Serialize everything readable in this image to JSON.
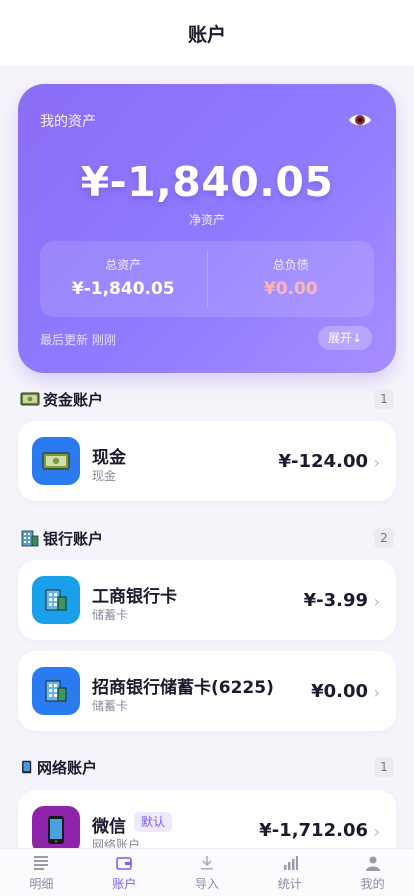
{
  "header": {
    "title": "账户"
  },
  "summary": {
    "label": "我的资产",
    "net_value": "¥-1,840.05",
    "net_label": "净资产",
    "total_assets_label": "总资产",
    "total_assets_value": "¥-1,840.05",
    "total_debt_label": "总负债",
    "total_debt_value": "¥0.00",
    "last_update": "最后更新 刚刚",
    "expand_label": "展开↓"
  },
  "sections": {
    "cash": {
      "title": "资金账户",
      "count": "1",
      "items": [
        {
          "name": "现金",
          "sub": "现金",
          "amount": "¥-124.00"
        }
      ]
    },
    "bank": {
      "title": "银行账户",
      "count": "2",
      "items": [
        {
          "name": "工商银行卡",
          "sub": "储蓄卡",
          "amount": "¥-3.99"
        },
        {
          "name": "招商银行储蓄卡(6225)",
          "sub": "储蓄卡",
          "amount": "¥0.00"
        }
      ]
    },
    "online": {
      "title": "网络账户",
      "count": "1",
      "items": [
        {
          "name": "微信",
          "tag": "默认",
          "sub": "网络账户",
          "amount": "¥-1,712.06"
        }
      ]
    }
  },
  "nav": {
    "items": [
      {
        "label": "明细"
      },
      {
        "label": "账户"
      },
      {
        "label": "导入"
      },
      {
        "label": "统计"
      },
      {
        "label": "我的"
      }
    ]
  },
  "colors": {
    "accent": "#7a5cf0",
    "card_gradient_start": "#8c6cf6",
    "debt": "#ffb6b0"
  },
  "icons": [
    "eye-icon",
    "cash-icon",
    "bank-icon",
    "phone-icon",
    "list-icon",
    "wallet-icon",
    "import-icon",
    "stats-icon",
    "user-icon"
  ]
}
